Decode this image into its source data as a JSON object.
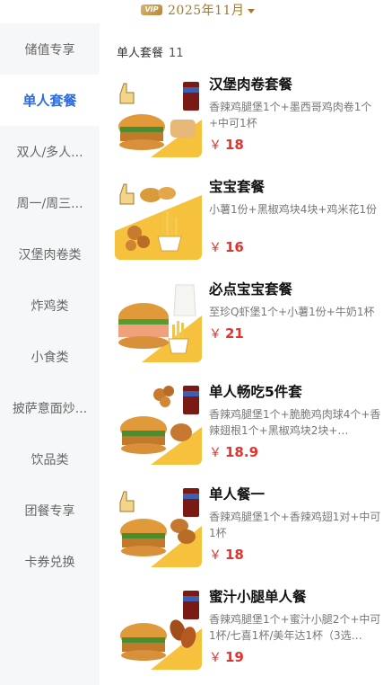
{
  "header": {
    "vip_badge": "VIP",
    "month": "2025年11月"
  },
  "sidebar": {
    "items": [
      {
        "label": "储值专享"
      },
      {
        "label": "单人套餐",
        "active": true
      },
      {
        "label": "双人/多人..."
      },
      {
        "label": "周一/周三..."
      },
      {
        "label": "汉堡肉卷类"
      },
      {
        "label": "炸鸡类"
      },
      {
        "label": "小食类"
      },
      {
        "label": "披萨意面炒..."
      },
      {
        "label": "饮品类"
      },
      {
        "label": "团餐专享"
      },
      {
        "label": "卡券兑换"
      }
    ]
  },
  "section": {
    "title": "单人套餐",
    "count": "11"
  },
  "products": [
    {
      "name": "汉堡肉卷套餐",
      "desc": "香辣鸡腿堡1个+墨西哥鸡肉卷1个+中可1杯",
      "currency": "￥",
      "price": "18",
      "image": "burger-combo-wrap-image"
    },
    {
      "name": "宝宝套餐",
      "desc": "小薯1份+黑椒鸡块4块+鸡米花1份",
      "currency": "￥",
      "price": "16",
      "image": "nuggets-fries-image"
    },
    {
      "name": "必点宝宝套餐",
      "desc": "至珍Q虾堡1个+小薯1份+牛奶1杯",
      "currency": "￥",
      "price": "21",
      "image": "shrimp-burger-milk-image"
    },
    {
      "name": "单人畅吃5件套",
      "desc": "香辣鸡腿堡1个+脆脆鸡肉球4个+香辣翅根1个+黑椒鸡块2块+…",
      "currency": "￥",
      "price": "18.9",
      "image": "five-piece-combo-image"
    },
    {
      "name": "单人餐一",
      "desc": "香辣鸡腿堡1个+香辣鸡翅1对+中可1杯",
      "currency": "￥",
      "price": "18",
      "image": "burger-wings-cola-image"
    },
    {
      "name": "蜜汁小腿单人餐",
      "desc": "香辣鸡腿堡1个+蜜汁小腿2个+中可1杯/七喜1杯/美年达1杯（3选…",
      "currency": "￥",
      "price": "19",
      "image": "honey-drumstick-combo-image"
    }
  ],
  "colors": {
    "accent": "#2d6be0",
    "price": "#e5322d",
    "gold": "#a5782c",
    "sidebar_bg": "#f6f7f8"
  }
}
